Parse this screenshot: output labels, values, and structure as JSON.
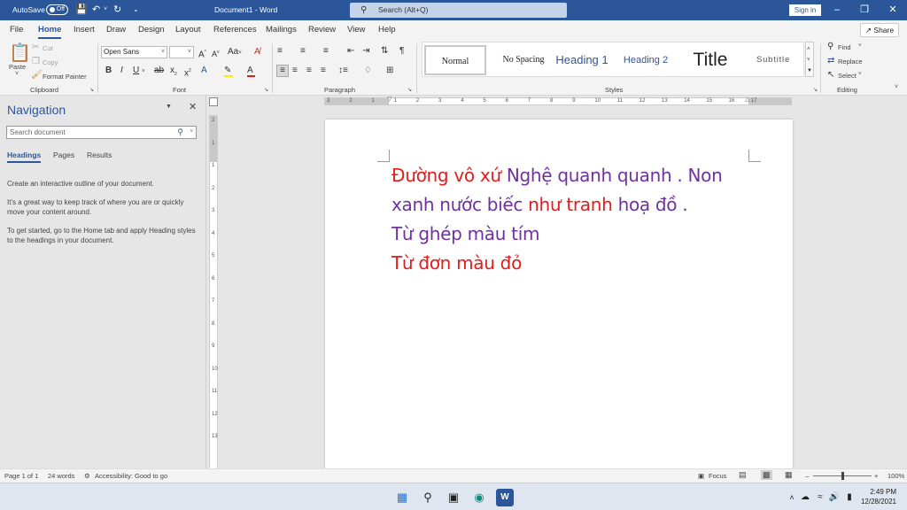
{
  "titlebar": {
    "autosave": "AutoSave",
    "toggle": "Off",
    "doc_title": "Document1  -  Word",
    "search": "Search (Alt+Q)",
    "signin": "Sign in"
  },
  "menu": {
    "tabs": [
      "File",
      "Home",
      "Insert",
      "Draw",
      "Design",
      "Layout",
      "References",
      "Mailings",
      "Review",
      "View",
      "Help"
    ],
    "active": "Home",
    "share": "Share"
  },
  "ribbon": {
    "clipboard": {
      "paste": "Paste",
      "cut": "Cut",
      "copy": "Copy",
      "format_painter": "Format Painter",
      "label": "Clipboard"
    },
    "font": {
      "name": "Open Sans",
      "size": "",
      "label": "Font"
    },
    "paragraph": {
      "label": "Paragraph"
    },
    "styles": {
      "items": [
        "Normal",
        "No Spacing",
        "Heading 1",
        "Heading 2",
        "Title",
        "Subtitle"
      ],
      "selected": "Normal",
      "label": "Styles"
    },
    "editing": {
      "find": "Find",
      "replace": "Replace",
      "select": "Select",
      "label": "Editing"
    }
  },
  "navigation": {
    "title": "Navigation",
    "search_placeholder": "Search document",
    "tabs": [
      "Headings",
      "Pages",
      "Results"
    ],
    "active_tab": "Headings",
    "para1": "Create an interactive outline of your document.",
    "para2": "It's a great way to keep track of where you are or quickly move your content around.",
    "para3": "To get started, go to the Home tab and apply Heading styles to the headings in your document."
  },
  "document": {
    "line1_red": "Đường vô xứ ",
    "line1_purple": "Nghệ quanh quanh . Non",
    "line2_purple_a": "xanh nước biếc ",
    "line2_red": "như tranh ",
    "line2_purple_b": "hoạ đồ .",
    "line3": "Từ ghép màu tím",
    "line4": "Từ đơn màu đỏ",
    "colors": {
      "red": "#e51c1c",
      "purple": "#7030a0"
    }
  },
  "ruler": {
    "h_labels": [
      "3",
      "2",
      "1",
      "1",
      "2",
      "3",
      "4",
      "5",
      "6",
      "7",
      "8",
      "9",
      "10",
      "11",
      "12",
      "13",
      "14",
      "15",
      "16",
      "17"
    ],
    "v_labels": [
      "2",
      "1",
      "1",
      "2",
      "3",
      "4",
      "5",
      "6",
      "7",
      "8",
      "9",
      "10",
      "11",
      "12",
      "13"
    ]
  },
  "status": {
    "page": "Page 1 of 1",
    "words": "24 words",
    "accessibility": "Accessibility: Good to go",
    "focus": "Focus",
    "zoom": "100%"
  },
  "taskbar": {
    "time": "2:49 PM",
    "date": "12/28/2021"
  }
}
